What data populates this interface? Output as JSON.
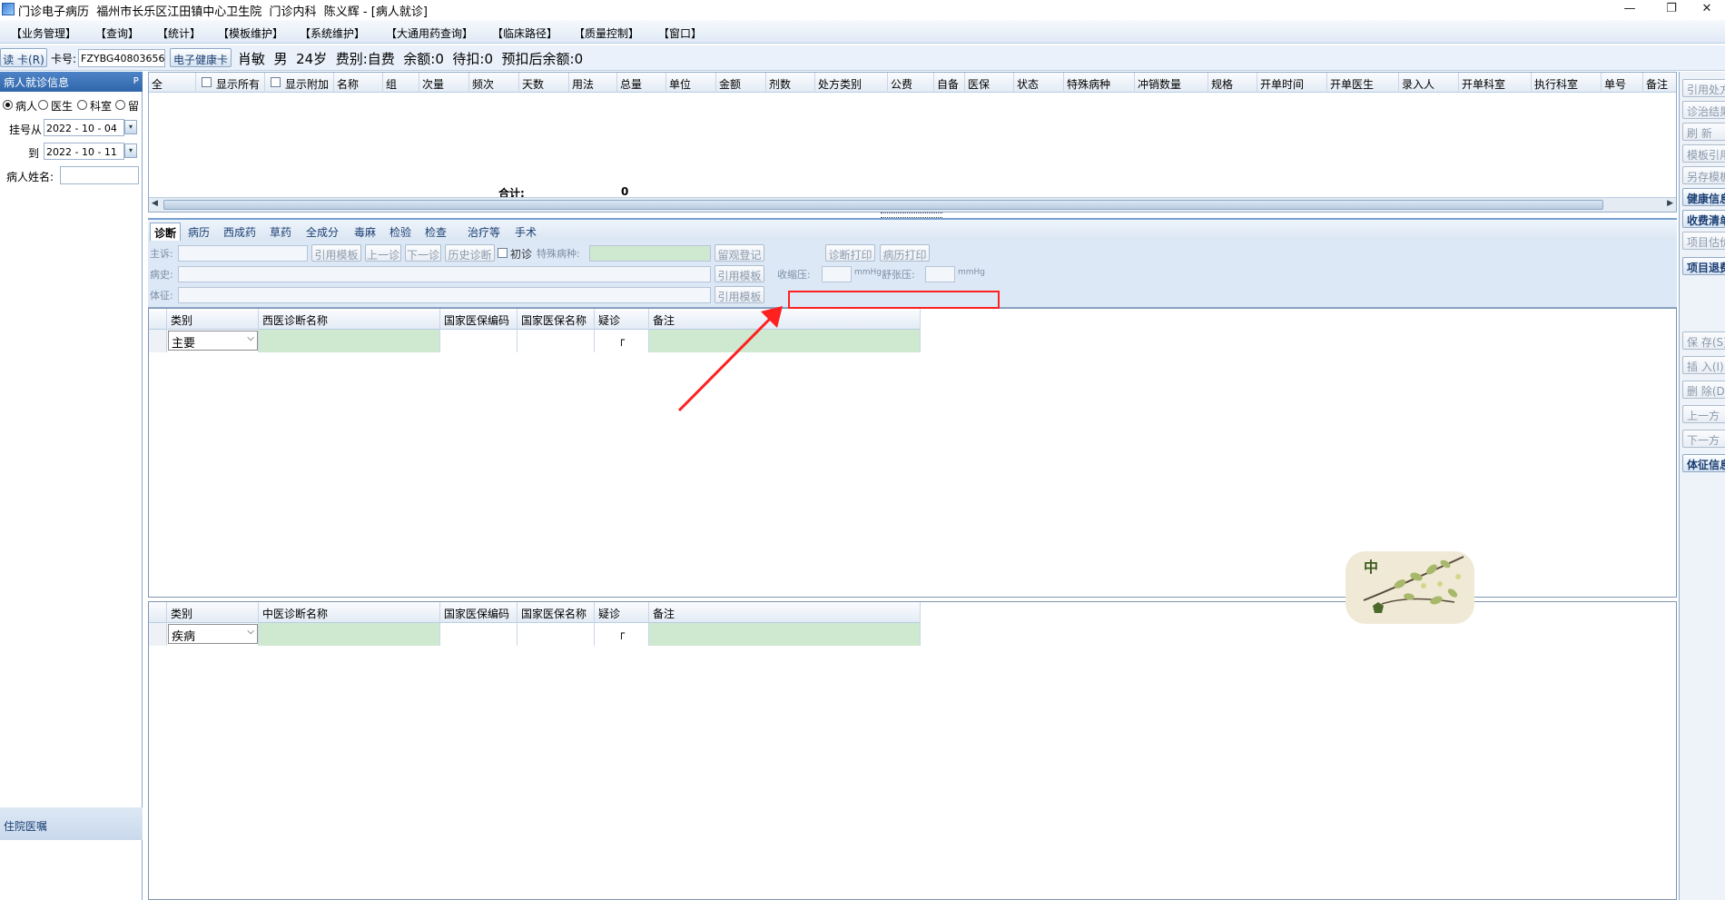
{
  "titlebar": {
    "title": "门诊电子病历  福州市长乐区江田镇中心卫生院  门诊内科  陈义辉 - [病人就诊]",
    "min": "—",
    "restore": "❐",
    "close": "✕"
  },
  "menu": [
    "【业务管理】",
    "【查询】",
    "【统计】",
    "【模板维护】",
    "【系统维护】",
    "【大通用药查询】",
    "【临床路径】",
    "【质量控制】",
    "【窗口】"
  ],
  "patientbar": {
    "read_card": "读 卡(R)",
    "card_label": "卡号:",
    "card_value": "FZYBG40803656",
    "health_card": "电子健康卡",
    "info": "肖敏  男  24岁  费别:自费  余额:0  待扣:0  预扣后余额:0"
  },
  "leftpanel": {
    "header": "病人就诊信息",
    "pin": "ᴘ",
    "radios": [
      "病人",
      "医生",
      "科室",
      "留"
    ],
    "reg_from_label": "挂号从",
    "reg_from": "2022 - 10 - 04",
    "to_label": "到",
    "reg_to": "2022 - 10 - 11",
    "name_label": "病人姓名:",
    "name_value": "",
    "bottom_header": "住院医嘱"
  },
  "rxgrid": {
    "columns": [
      "全",
      "显示所有",
      "显示附加",
      "名称",
      "组",
      "次量",
      "频次",
      "天数",
      "用法",
      "总量",
      "单位",
      "金额",
      "剂数",
      "处方类别",
      "公费",
      "自备",
      "医保",
      "状态",
      "特殊病种",
      "冲销数量",
      "规格",
      "开单时间",
      "开单医生",
      "录入人",
      "开单科室",
      "执行科室",
      "单号",
      "备注"
    ],
    "total_label": "合计:",
    "total_value": "0"
  },
  "tabs": [
    "诊断",
    "病历",
    "西成药",
    "草药",
    "全成分",
    "毒麻",
    "检验",
    "检查",
    "治疗等",
    "手术"
  ],
  "diagform": {
    "complaint_label": "主诉:",
    "history_label": "病史:",
    "sign_label": "体征:",
    "quote_template": "引用模板",
    "prev_visit": "上一诊",
    "next_visit": "下一诊",
    "history_diag": "历史诊断",
    "first_visit": "初诊",
    "special_disease_label": "特殊病种:",
    "observe_reg": "留观登记",
    "diag_print": "诊断打印",
    "record_print": "病历打印",
    "systolic_label": "收缩压:",
    "diastolic_label": "舒张压:",
    "unit": "mmHg"
  },
  "wgrid": {
    "headers": [
      "类别",
      "西医诊断名称",
      "国家医保编码",
      "国家医保名称",
      "疑诊",
      "备注"
    ],
    "row_type": "主要",
    "suspect_mark": "┌"
  },
  "cgrid": {
    "headers": [
      "类别",
      "中医诊断名称",
      "国家医保编码",
      "国家医保名称",
      "疑诊",
      "备注"
    ],
    "row_type": "疾病",
    "suspect_mark": "┌"
  },
  "righttb": {
    "top": [
      "引用处方",
      "诊治结果",
      "刷 新",
      "模板引用",
      "另存模板",
      "健康信息",
      "收费清单",
      "项目估价",
      "项目退费"
    ],
    "bottom": [
      "保 存(S)",
      "插 入(I)",
      "删 除(D)",
      "上一方",
      "下一方",
      "体征信息"
    ]
  },
  "logo": {
    "text": "中"
  },
  "colors": {
    "accent": "#2f66ab",
    "green_cell": "#cfe8d0",
    "annotation": "#ff2020"
  }
}
